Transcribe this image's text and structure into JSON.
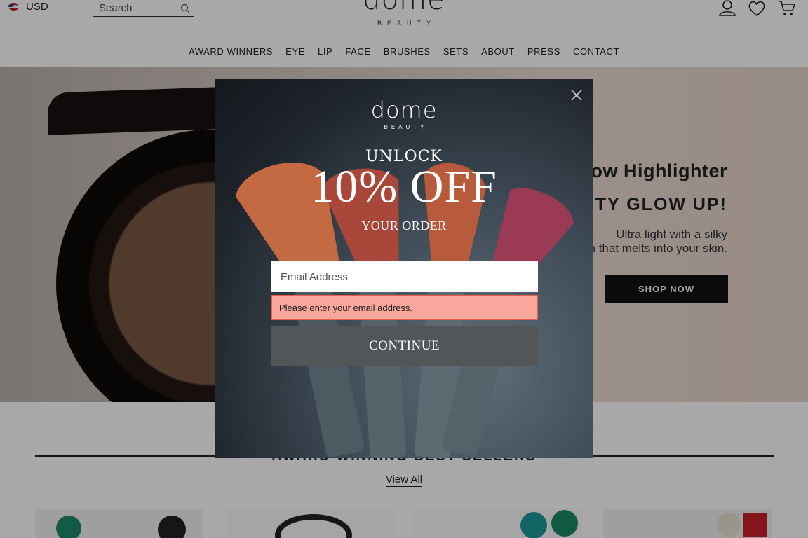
{
  "header": {
    "currency": "USD",
    "search": {
      "placeholder": "Search"
    },
    "logo": {
      "wordmark": "dome",
      "subtitle": "BEAUTY"
    },
    "icons": [
      "account-icon",
      "wishlist-heart-icon",
      "cart-icon"
    ]
  },
  "nav": {
    "items": [
      "AWARD WINNERS",
      "EYE",
      "LIP",
      "FACE",
      "BRUSHES",
      "SETS",
      "ABOUT",
      "PRESS",
      "CONTACT"
    ]
  },
  "hero": {
    "title": "ow Highlighter",
    "headline": "UTY GLOW UP!",
    "description_line1": "Ultra light with a silky",
    "description_line2": "sh that melts into your skin.",
    "cta": "SHOP NOW"
  },
  "section": {
    "title": "AWARD WINNING BEST SELLERS",
    "view_all": "View All"
  },
  "modal": {
    "logo": {
      "wordmark": "dome",
      "subtitle": "BEAUTY"
    },
    "unlock": "UNLOCK",
    "offer": "10% OFF",
    "your_order": "YOUR ORDER",
    "email": {
      "placeholder": "Email Address",
      "value": ""
    },
    "error": "Please enter your email address.",
    "continue": "CONTINUE"
  },
  "colors": {
    "overlay": "rgba(0,0,0,0.34)",
    "error_bg": "#f9a79d",
    "error_border": "#e75c4d",
    "continue_bg": "#535658",
    "shop_btn_bg": "#111111"
  }
}
